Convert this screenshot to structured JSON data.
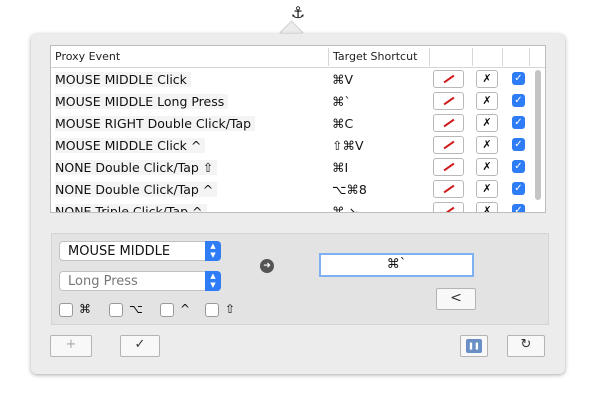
{
  "table": {
    "headers": [
      "Proxy Event",
      "Target Shortcut"
    ],
    "rows": [
      {
        "event": "MOUSE MIDDLE Click",
        "shortcut": "⌘V"
      },
      {
        "event": "MOUSE MIDDLE Long Press",
        "shortcut": "⌘`"
      },
      {
        "event": "MOUSE RIGHT Double Click/Tap",
        "shortcut": "⌘C"
      },
      {
        "event": "MOUSE MIDDLE Click ^",
        "shortcut": "⇧⌘V"
      },
      {
        "event": "NONE Double Click/Tap ⇧",
        "shortcut": "⌘I"
      },
      {
        "event": "NONE Double Click/Tap ^",
        "shortcut": "⌥⌘8"
      },
      {
        "event": "NONE Triple Click/Tap ^",
        "shortcut": "⌘ ↘"
      }
    ]
  },
  "editor": {
    "device_select": "MOUSE MIDDLE",
    "action_select": "Long Press",
    "modifiers": [
      "⌘",
      "⌥",
      "^",
      "⇧"
    ],
    "shortcut_value": "⌘`",
    "back_label": "<"
  },
  "footer": {
    "add_label": "+",
    "confirm_label": "✓",
    "pause_label": "❚❚",
    "reset_label": "↻"
  },
  "icons": {
    "anchor": "⚓",
    "go": "➜",
    "delete": "✗",
    "checked": "✓"
  },
  "colors": {
    "accent": "#2e7cf6",
    "edit_pen": "#d01818"
  }
}
